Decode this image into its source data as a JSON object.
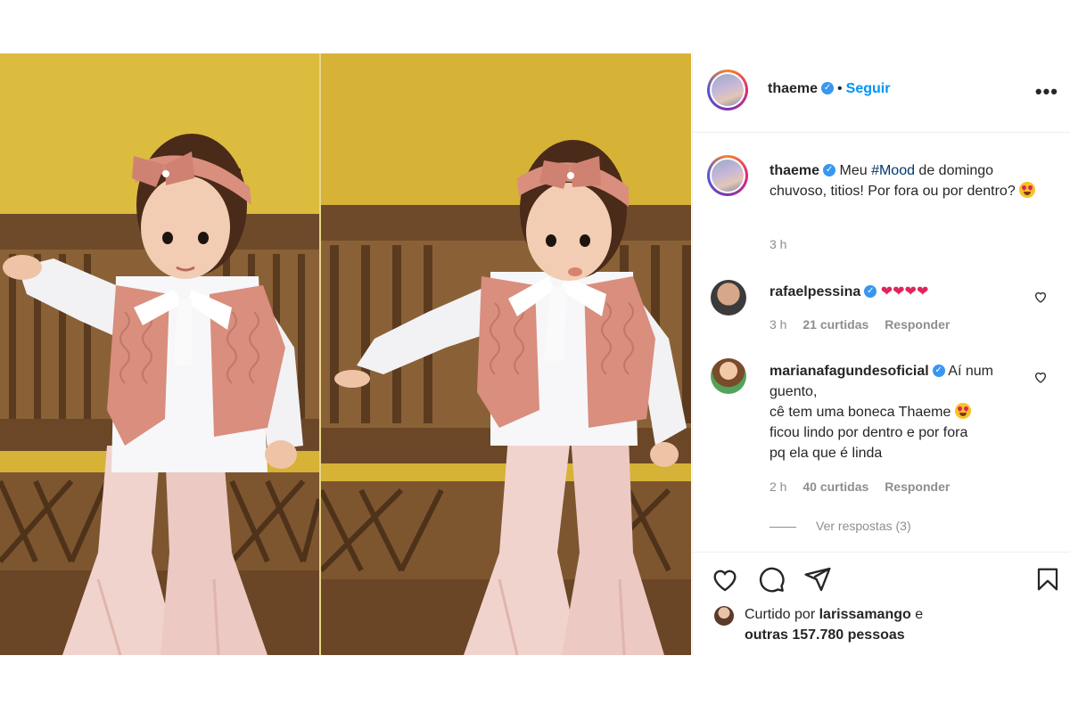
{
  "post": {
    "author": "thaeme",
    "separator": "•",
    "follow_label": "Seguir",
    "more_label": "•••",
    "caption_before": "Meu ",
    "caption_hashtag": "#Mood",
    "caption_after": " de domingo chuvoso, titios! Por fora ou por dentro?",
    "caption_time": "3 h",
    "photo_alt": "Two photos of a toddler in a pink knit vest, white blouse and pink flared pants against a yellow wall"
  },
  "comments": [
    {
      "user": "rafaelpessina",
      "text": "",
      "time": "3 h",
      "likes": "21 curtidas",
      "reply_label": "Responder"
    },
    {
      "user": "marianafagundesoficial",
      "text_line1": "Aí num guento,",
      "text_line2": "cê tem uma boneca Thaeme",
      "text_line3": "ficou lindo por dentro e por fora",
      "text_line4": "pq ela que é linda",
      "time": "2 h",
      "likes": "40 curtidas",
      "reply_label": "Responder"
    }
  ],
  "view_replies": "Ver respostas (3)",
  "liked_by": {
    "prefix": "Curtido por",
    "user": "larissamango",
    "connector": "e",
    "others": "outras 157.780 pessoas"
  },
  "icons": {
    "like": "heart-outline-icon",
    "comment": "comment-bubble-icon",
    "share": "paper-plane-icon",
    "save": "bookmark-icon",
    "verified": "verified-badge-icon"
  },
  "colors": {
    "link_blue": "#0095f6",
    "verified_blue": "#3897f0",
    "wall_yellow": "#d9b63a",
    "vest_pink": "#d98e7e",
    "pants_pink": "#f1d3cd"
  }
}
